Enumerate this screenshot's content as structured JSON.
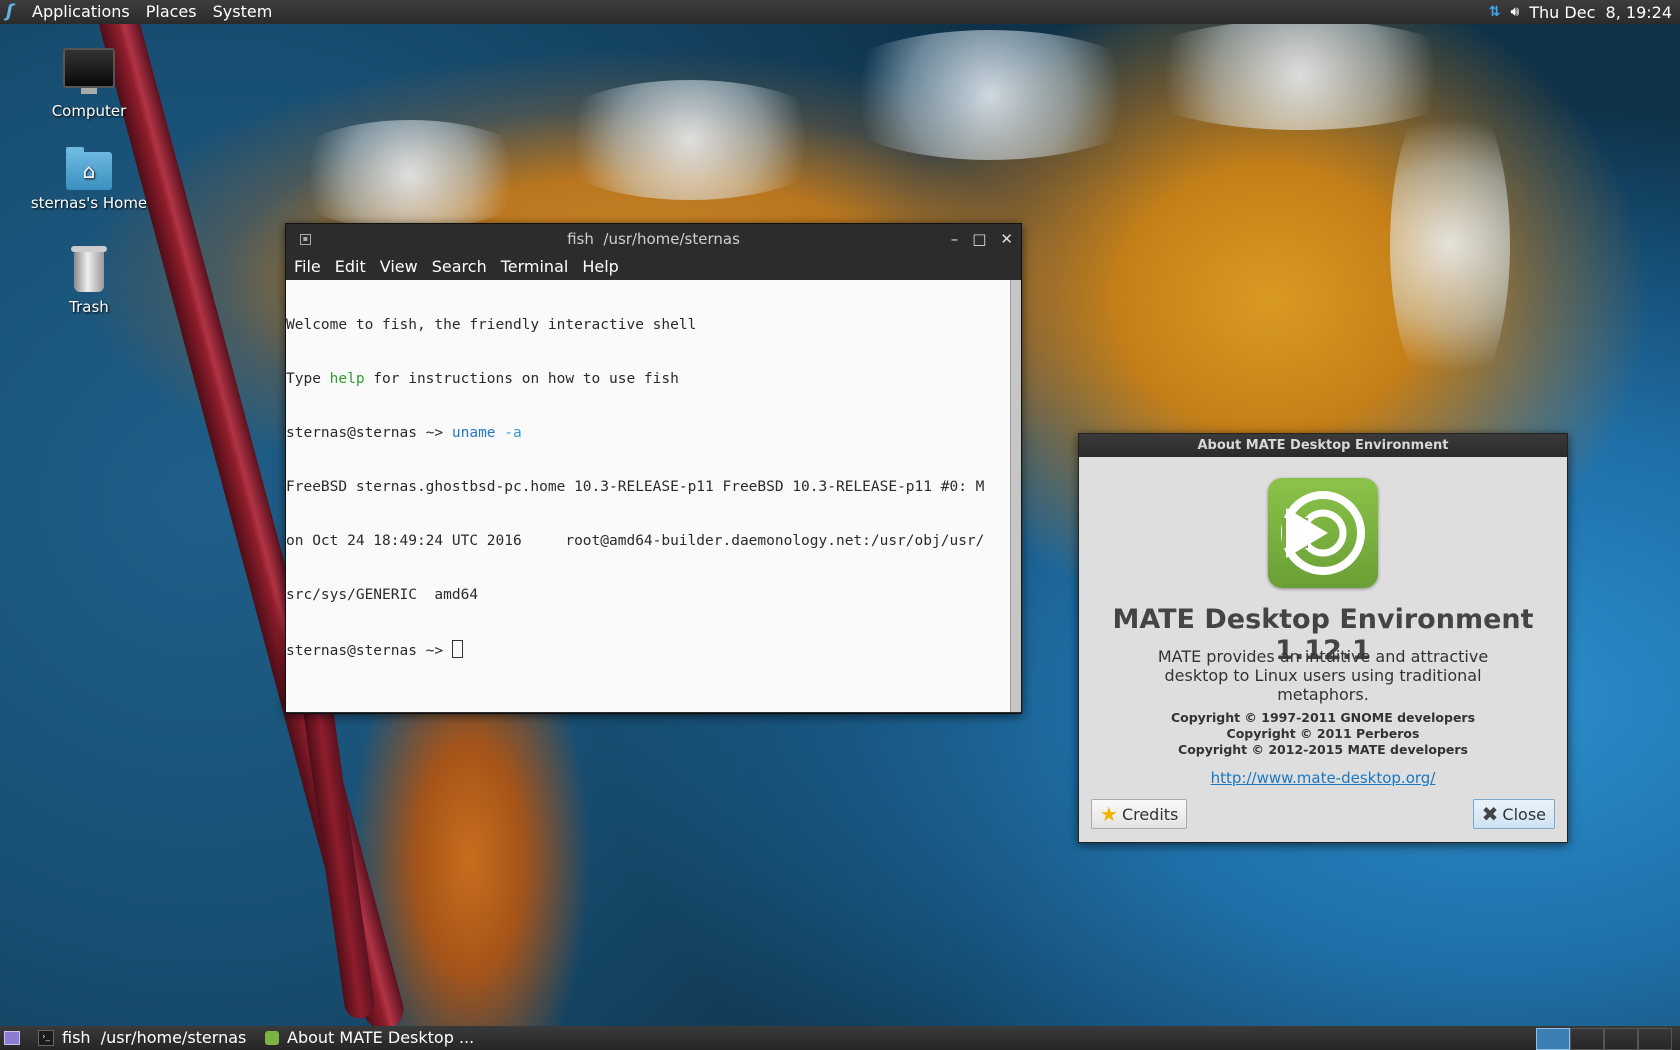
{
  "top_panel": {
    "menus": [
      "Applications",
      "Places",
      "System"
    ],
    "clock": "Thu Dec  8, 19:24"
  },
  "desktop_icons": [
    {
      "label": "Computer",
      "icon": "computer-icon"
    },
    {
      "label": "sternas's Home",
      "icon": "home-folder-icon"
    },
    {
      "label": "Trash",
      "icon": "trash-icon"
    }
  ],
  "terminal": {
    "title": "fish  /usr/home/sternas",
    "menus": [
      "File",
      "Edit",
      "View",
      "Search",
      "Terminal",
      "Help"
    ],
    "lines": {
      "l1": "Welcome to fish, the friendly interactive shell",
      "l2a": "Type ",
      "l2b": "help",
      "l2c": " for instructions on how to use fish",
      "prompt": "sternas@sternas ~> ",
      "cmd_a": "uname ",
      "cmd_b": "-a",
      "out1": "FreeBSD sternas.ghostbsd-pc.home 10.3-RELEASE-p11 FreeBSD 10.3-RELEASE-p11 #0: M",
      "out2": "on Oct 24 18:49:24 UTC 2016     root@amd64-builder.daemonology.net:/usr/obj/usr/",
      "out3": "src/sys/GENERIC  amd64"
    }
  },
  "about": {
    "title": "About MATE Desktop Environment",
    "app_name": "MATE Desktop Environment 1.12.1",
    "description": "MATE provides an intuitive and attractive desktop to Linux users using traditional metaphors.",
    "copyright": [
      "Copyright © 1997-2011 GNOME developers",
      "Copyright © 2011 Perberos",
      "Copyright © 2012-2015 MATE developers"
    ],
    "link": "http://www.mate-desktop.org/",
    "credits_label": "Credits",
    "close_label": "Close"
  },
  "taskbar": {
    "items": [
      "fish  /usr/home/sternas",
      "About MATE Desktop ..."
    ]
  },
  "colors": {
    "panel": "#2b2b2b",
    "link": "#1a78c2",
    "mate_green": "#7bb440"
  }
}
